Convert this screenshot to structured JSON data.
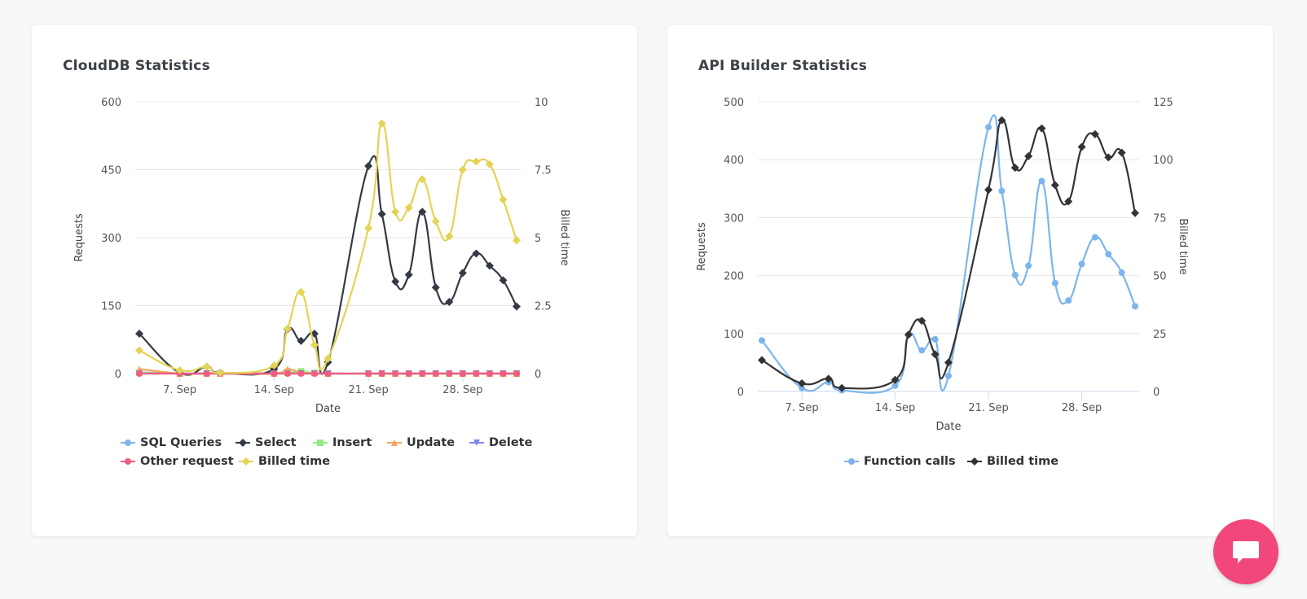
{
  "chat": {
    "icon": "chat-bubble-icon",
    "color": "#f2477a"
  },
  "chart_data": [
    {
      "id": "clouddb",
      "type": "line",
      "title": "CloudDB Statistics",
      "xlabel": "Date",
      "ylabel": "Requests",
      "y2label": "Billed time",
      "ylim": [
        0,
        600
      ],
      "y2lim": [
        0,
        10
      ],
      "yticks": [
        "0",
        "150",
        "300",
        "450",
        "600"
      ],
      "y2ticks": [
        "0",
        "2.5",
        "5",
        "7.5",
        "10"
      ],
      "xticks": [
        {
          "day": 3,
          "label": "7. Sep"
        },
        {
          "day": 10,
          "label": "14. Sep"
        },
        {
          "day": 17,
          "label": "21. Sep"
        },
        {
          "day": 24,
          "label": "28. Sep"
        }
      ],
      "x_day_range": [
        0,
        28
      ],
      "x_days": [
        0,
        3,
        5,
        6,
        10,
        11,
        12,
        13,
        14,
        17,
        18,
        19,
        20,
        21,
        22,
        23,
        24,
        25,
        26,
        27,
        28
      ],
      "series": [
        {
          "name": "SQL Queries",
          "color": "#7cb5ec",
          "marker": "circle",
          "axis": 0,
          "values": [
            3,
            0,
            1,
            0,
            1,
            2,
            1,
            1,
            0,
            0,
            0,
            0,
            0,
            0,
            0,
            0,
            0,
            0,
            0,
            0,
            0
          ]
        },
        {
          "name": "Select",
          "color": "#333a45",
          "marker": "diamond",
          "axis": 0,
          "values": [
            88,
            2,
            15,
            2,
            10,
            98,
            72,
            88,
            25,
            458,
            352,
            203,
            218,
            357,
            190,
            158,
            222,
            265,
            238,
            206,
            148
          ]
        },
        {
          "name": "Insert",
          "color": "#90ed7d",
          "marker": "square",
          "axis": 0,
          "values": [
            2,
            0,
            0,
            0,
            0,
            2,
            5,
            1,
            0,
            0,
            0,
            0,
            0,
            0,
            0,
            0,
            0,
            0,
            0,
            0,
            0
          ]
        },
        {
          "name": "Update",
          "color": "#f7a35c",
          "marker": "triangle",
          "axis": 0,
          "values": [
            10,
            0,
            0,
            0,
            0,
            10,
            2,
            1,
            0,
            0,
            0,
            0,
            0,
            0,
            0,
            0,
            0,
            0,
            0,
            0,
            0
          ]
        },
        {
          "name": "Delete",
          "color": "#8085e9",
          "marker": "triangle-down",
          "axis": 0,
          "values": [
            0,
            0,
            0,
            0,
            0,
            0,
            0,
            0,
            0,
            0,
            0,
            0,
            0,
            0,
            0,
            0,
            0,
            0,
            0,
            0,
            0
          ]
        },
        {
          "name": "Other request",
          "color": "#f15c80",
          "marker": "circle",
          "axis": 0,
          "values": [
            0,
            0,
            0,
            0,
            0,
            0,
            0,
            0,
            0,
            0,
            0,
            0,
            0,
            0,
            0,
            0,
            0,
            0,
            0,
            0,
            0
          ]
        },
        {
          "name": "Billed time",
          "color": "#e4d354",
          "marker": "diamond",
          "axis": 1,
          "values": [
            0.85,
            0.12,
            0.25,
            0.03,
            0.3,
            1.65,
            3.0,
            1.05,
            0.55,
            5.35,
            9.2,
            5.95,
            6.1,
            7.15,
            5.6,
            5.05,
            7.5,
            7.8,
            7.7,
            6.4,
            4.9
          ]
        }
      ],
      "legend": "bottom-center"
    },
    {
      "id": "apibuilder",
      "type": "line",
      "title": "API Builder Statistics",
      "xlabel": "Date",
      "ylabel": "Requests",
      "y2label": "Billed time",
      "ylim": [
        0,
        500
      ],
      "y2lim": [
        0,
        125
      ],
      "yticks": [
        "0",
        "100",
        "200",
        "300",
        "400",
        "500"
      ],
      "y2ticks": [
        "0",
        "25",
        "50",
        "75",
        "100",
        "125"
      ],
      "xticks": [
        {
          "day": 3,
          "label": "7. Sep"
        },
        {
          "day": 10,
          "label": "14. Sep"
        },
        {
          "day": 17,
          "label": "21. Sep"
        },
        {
          "day": 24,
          "label": "28. Sep"
        }
      ],
      "x_day_range": [
        0,
        28
      ],
      "x_days": [
        0,
        3,
        5,
        6,
        10,
        11,
        12,
        13,
        14,
        17,
        18,
        19,
        20,
        21,
        22,
        23,
        24,
        25,
        26,
        27,
        28
      ],
      "series": [
        {
          "name": "Function calls",
          "color": "#7cb5ec",
          "marker": "circle",
          "axis": 0,
          "values": [
            88,
            6,
            16,
            2,
            10,
            98,
            71,
            90,
            27,
            456,
            346,
            201,
            217,
            363,
            187,
            157,
            220,
            266,
            237,
            205,
            147
          ]
        },
        {
          "name": "Billed time",
          "color": "#333333",
          "marker": "diamond",
          "axis": 1,
          "values": [
            13.5,
            3.5,
            5.5,
            1.5,
            5,
            24.5,
            30.5,
            16,
            12.5,
            87,
            117,
            96.5,
            101.5,
            113.5,
            89,
            82,
            105.5,
            111,
            101,
            103,
            77
          ]
        }
      ],
      "legend": "bottom-center"
    }
  ]
}
